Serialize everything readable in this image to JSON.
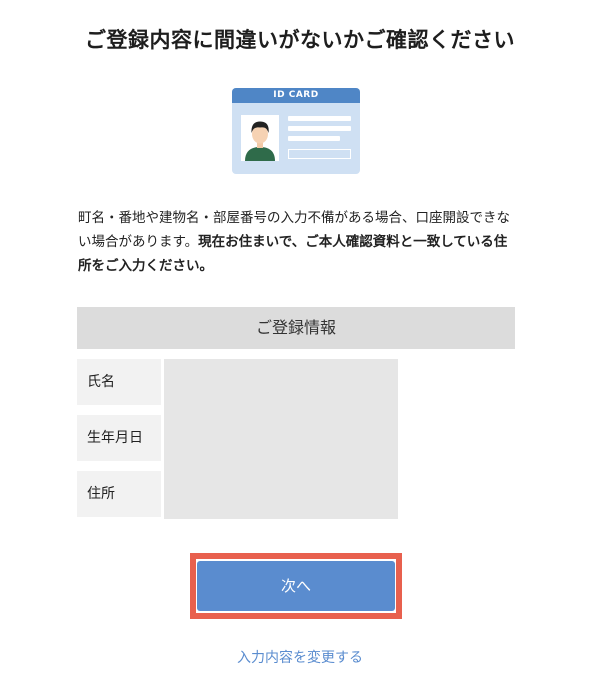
{
  "page": {
    "title": "ご登録内容に間違いがないかご確認ください"
  },
  "id_card": {
    "label": "ID CARD",
    "icon": "id-card-icon"
  },
  "description": {
    "normal": "町名・番地や建物名・部屋番号の入力不備がある場合、口座開設できない場合があります。",
    "bold": "現在お住まいで、ご本人確認資料と一致している住所をご入力ください。"
  },
  "registration": {
    "header": "ご登録情報",
    "fields": [
      {
        "label": "氏名"
      },
      {
        "label": "生年月日"
      },
      {
        "label": "住所"
      }
    ]
  },
  "actions": {
    "next_label": "次へ",
    "edit_label": "入力内容を変更する"
  },
  "colors": {
    "primary": "#5a8ccf",
    "highlight": "#e8604e",
    "header_bg": "#dcdcdc",
    "card_bg": "#cfe0f3",
    "card_header": "#4f86c6"
  }
}
